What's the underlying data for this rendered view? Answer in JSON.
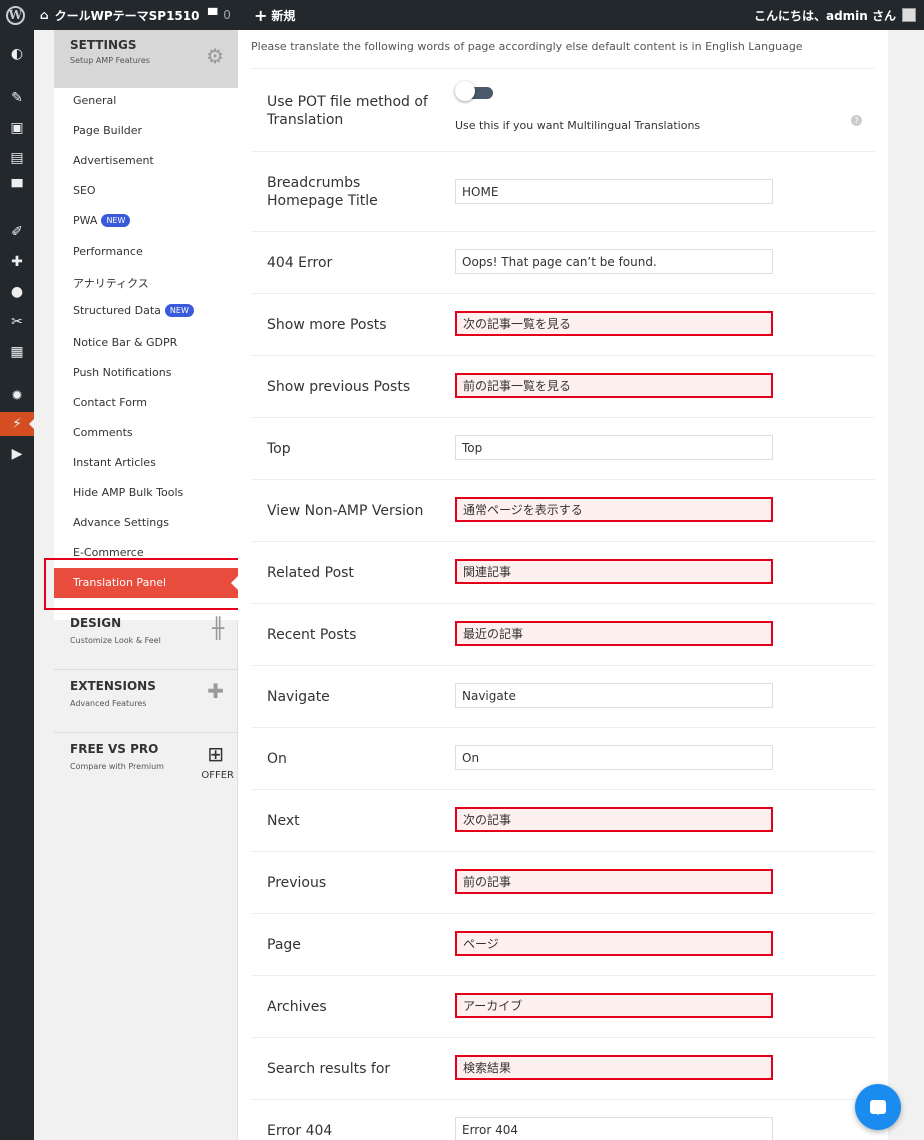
{
  "adminbar": {
    "site_name": "クールWPテーマSP1510",
    "comments_count": "0",
    "new_label": "新規",
    "howdy": "こんにちは、admin さん"
  },
  "settings_nav": {
    "section_title": "SETTINGS",
    "section_subtitle": "Setup AMP Features",
    "items": [
      {
        "label": "General"
      },
      {
        "label": "Page Builder"
      },
      {
        "label": "Advertisement"
      },
      {
        "label": "SEO"
      },
      {
        "label": "PWA",
        "badge": "NEW"
      },
      {
        "label": "Performance"
      },
      {
        "label": "アナリティクス"
      },
      {
        "label": "Structured Data",
        "badge": "NEW"
      },
      {
        "label": "Notice Bar & GDPR"
      },
      {
        "label": "Push Notifications"
      },
      {
        "label": "Contact Form"
      },
      {
        "label": "Comments"
      },
      {
        "label": "Instant Articles"
      },
      {
        "label": "Hide AMP Bulk Tools"
      },
      {
        "label": "Advance Settings"
      },
      {
        "label": "E-Commerce"
      }
    ],
    "active_item": "Translation Panel",
    "groups": [
      {
        "title": "DESIGN",
        "subtitle": "Customize Look & Feel"
      },
      {
        "title": "EXTENSIONS",
        "subtitle": "Advanced Features"
      },
      {
        "title": "FREE VS PRO",
        "subtitle": "Compare with Premium",
        "extra": "OFFER"
      }
    ]
  },
  "main": {
    "intro": "Please translate the following words of page accordingly else default content is in English Language",
    "pot_label_1": "Use POT file method of",
    "pot_label_2": "Translation",
    "pot_help": "Use this if you want Multilingual Translations",
    "pot_enabled": false,
    "fields": [
      {
        "label_1": "Breadcrumbs",
        "label_2": "Homepage Title",
        "value": "HOME",
        "highlight": false
      },
      {
        "label_1": "404 Error",
        "value": "Oops! That page can’t be found.",
        "highlight": false
      },
      {
        "label_1": "Show more Posts",
        "value": "次の記事一覧を見る",
        "highlight": true
      },
      {
        "label_1": "Show previous Posts",
        "value": "前の記事一覧を見る",
        "highlight": true
      },
      {
        "label_1": "Top",
        "value": "Top",
        "highlight": false
      },
      {
        "label_1": "View Non-AMP Version",
        "value": "通常ページを表示する",
        "highlight": true
      },
      {
        "label_1": "Related Post",
        "value": "関連記事",
        "highlight": true
      },
      {
        "label_1": "Recent Posts",
        "value": "最近の記事",
        "highlight": true
      },
      {
        "label_1": "Navigate",
        "value": "Navigate",
        "highlight": false
      },
      {
        "label_1": "On",
        "value": "On",
        "highlight": false
      },
      {
        "label_1": "Next",
        "value": "次の記事",
        "highlight": true
      },
      {
        "label_1": "Previous",
        "value": "前の記事",
        "highlight": true
      },
      {
        "label_1": "Page",
        "value": "ページ",
        "highlight": true
      },
      {
        "label_1": "Archives",
        "value": "アーカイブ",
        "highlight": true
      },
      {
        "label_1": "Search results for",
        "value": "検索結果",
        "highlight": true
      },
      {
        "label_1": "Error 404",
        "value": "Error 404",
        "highlight": false
      }
    ]
  },
  "colors": {
    "accent_red": "#e74c3c",
    "highlight_border": "#e3001b",
    "admin_bar": "#23282d",
    "badge_blue": "#3a5bd9"
  },
  "icons": [
    "wordpress-icon",
    "home-icon",
    "comment-icon",
    "plus-icon",
    "gear-icon",
    "equalizer-icon",
    "puzzle-icon",
    "gift-icon",
    "question-icon",
    "chat-icon"
  ]
}
